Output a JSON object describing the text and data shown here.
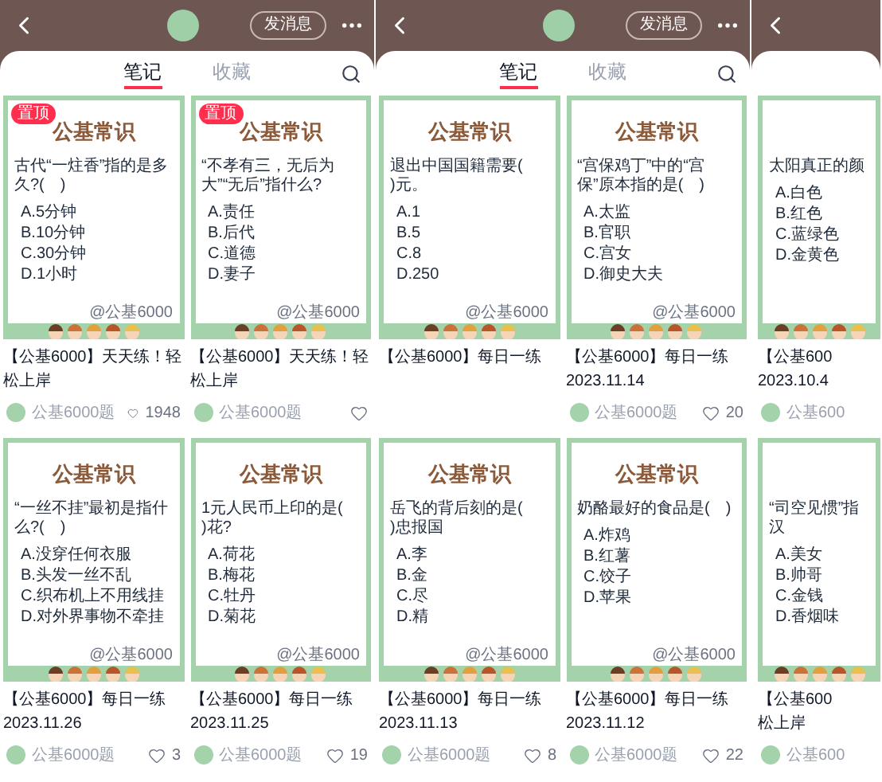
{
  "panels": [
    {
      "header": {
        "back": true,
        "avatar": true,
        "message_button": "发消息",
        "more": true
      },
      "tabs": [
        {
          "label": "笔记",
          "selected": true
        },
        {
          "label": "收藏",
          "selected": false
        }
      ],
      "search": true,
      "cards": [
        {
          "badge": "置顶",
          "logo": "公基常识",
          "question": "古代“一炷香”指的是多久?(　)",
          "options": [
            "A.5分钟",
            "B.10分钟",
            "C.30分钟",
            "D.1小时"
          ],
          "watermark": "@公基6000",
          "title_lines": [
            "【公基6000】天天练！轻",
            "松上岸"
          ],
          "author": "公基6000题",
          "heart": true,
          "likes": "1948"
        },
        {
          "badge": "置顶",
          "logo": "公基常识",
          "question": "“不孝有三，无后为大”“无后”指什么?",
          "options": [
            "A.责任",
            "B.后代",
            "C.道德",
            "D.妻子"
          ],
          "watermark": "@公基6000",
          "title_lines": [
            "【公基6000】天天练！轻",
            "松上岸"
          ],
          "author": "公基6000题",
          "heart": true
        },
        {
          "logo": "公基常识",
          "question": "“一丝不挂”最初是指什么?(　)",
          "options": [
            "A.没穿任何衣服",
            "B.头发一丝不乱",
            "C.织布机上不用线挂",
            "D.对外界事物不牵挂"
          ],
          "watermark": "@公基6000",
          "title_lines": [
            "【公基6000】每日一练",
            "2023.11.26"
          ],
          "author": "公基6000题",
          "heart": true,
          "likes": "3"
        },
        {
          "logo": "公基常识",
          "question": "1元人民币上印的是(　　)花?",
          "options": [
            "A.荷花",
            "B.梅花",
            "C.牡丹",
            "D.菊花"
          ],
          "watermark": "@公基6000",
          "title_lines": [
            "【公基6000】每日一练",
            "2023.11.25"
          ],
          "author": "公基6000题",
          "heart": true,
          "likes": "19"
        }
      ]
    },
    {
      "header": {
        "back": true,
        "avatar": true,
        "message_button": "发消息",
        "more": true
      },
      "tabs": [
        {
          "label": "笔记",
          "selected": true
        },
        {
          "label": "收藏",
          "selected": false
        }
      ],
      "search": true,
      "cards": [
        {
          "logo": "公基常识",
          "question": "退出中国国籍需要(　　)元。",
          "options": [
            "A.1",
            "B.5",
            "C.8",
            "D.250"
          ],
          "watermark": "@公基6000",
          "title_lines": [
            "【公基6000】每日一练"
          ]
        },
        {
          "logo": "公基常识",
          "question": "“宫保鸡丁”中的“宫保”原本指的是(　)",
          "options": [
            "A.太监",
            "B.官职",
            "C.宫女",
            "D.御史大夫"
          ],
          "watermark": "@公基6000",
          "title_lines": [
            "【公基6000】每日一练",
            "2023.11.14"
          ],
          "author": "公基6000题",
          "heart": true,
          "likes": "20"
        },
        {
          "logo": "公基常识",
          "question": "岳飞的背后刻的是(　　)忠报国",
          "options": [
            "A.李",
            "B.金",
            "C.尽",
            "D.精"
          ],
          "watermark": "@公基6000",
          "title_lines": [
            "【公基6000】每日一练",
            "2023.11.13"
          ],
          "author": "公基6000题",
          "heart": true,
          "likes": "8"
        },
        {
          "logo": "公基常识",
          "question": "奶酪最好的食品是(　)",
          "options": [
            "A.炸鸡",
            "B.红薯",
            "C.饺子",
            "D.苹果"
          ],
          "watermark": "@公基6000",
          "title_lines": [
            "【公基6000】每日一练",
            "2023.11.12"
          ],
          "author": "公基6000题",
          "heart": true,
          "likes": "22"
        }
      ]
    },
    {
      "header": {
        "back": true
      },
      "cards": [
        {
          "question": "太阳真正的颜",
          "options": [
            "A.白色",
            "B.红色",
            "C.蓝绿色",
            "D.金黄色"
          ],
          "title_lines": [
            "【公基600",
            "2023.10.4"
          ],
          "author": "公基600"
        },
        {
          "question": "“司空见惯”指汉",
          "options": [
            "A.美女",
            "B.帅哥",
            "C.金钱",
            "D.香烟味"
          ],
          "title_lines": [
            "【公基600",
            "松上岸"
          ],
          "author": "公基600"
        }
      ]
    }
  ]
}
